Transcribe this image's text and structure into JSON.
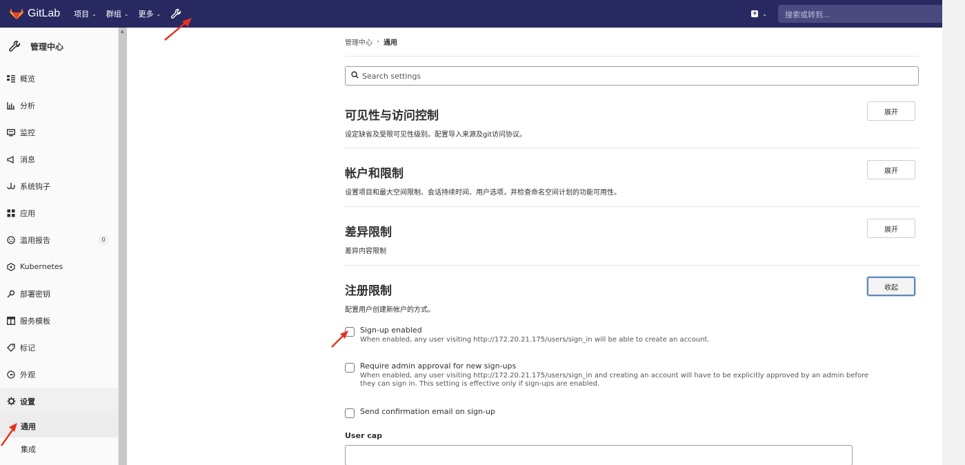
{
  "navbar": {
    "brand": "GitLab",
    "items": [
      {
        "label": "项目"
      },
      {
        "label": "群组"
      },
      {
        "label": "更多"
      }
    ],
    "search_placeholder": "搜索或转到..."
  },
  "sidebar": {
    "header": "管理中心",
    "items": [
      {
        "label": "概览",
        "icon": "overview-icon"
      },
      {
        "label": "分析",
        "icon": "chart-icon"
      },
      {
        "label": "监控",
        "icon": "monitor-icon"
      },
      {
        "label": "消息",
        "icon": "megaphone-icon"
      },
      {
        "label": "系统钩子",
        "icon": "hook-icon"
      },
      {
        "label": "应用",
        "icon": "apps-icon"
      },
      {
        "label": "滥用报告",
        "icon": "abuse-icon",
        "badge": "0"
      },
      {
        "label": "Kubernetes",
        "icon": "kubernetes-icon"
      },
      {
        "label": "部署密钥",
        "icon": "key-icon"
      },
      {
        "label": "服务模板",
        "icon": "template-icon"
      },
      {
        "label": "标记",
        "icon": "label-icon"
      },
      {
        "label": "外观",
        "icon": "appearance-icon"
      },
      {
        "label": "设置",
        "icon": "gear-icon"
      }
    ],
    "subitems": [
      {
        "label": "通用"
      },
      {
        "label": "集成"
      }
    ]
  },
  "breadcrumb": {
    "parent": "管理中心",
    "current": "通用"
  },
  "search_settings": {
    "placeholder": "Search settings"
  },
  "sections": [
    {
      "title": "可见性与访问控制",
      "desc": "设定缺省及受限可见性级别。配置导入来源及git访问协议。",
      "button": "展开"
    },
    {
      "title": "帐户和限制",
      "desc": "设置项目和最大空间限制、会话持续时间、用户选项，并检查命名空间计划的功能可用性。",
      "button": "展开"
    },
    {
      "title": "差异限制",
      "desc": "差异内容限制",
      "button": "展开"
    },
    {
      "title": "注册限制",
      "desc": "配置用户创建新帐户的方式。",
      "button": "收起"
    }
  ],
  "signup": {
    "enabled_label": "Sign-up enabled",
    "enabled_help": "When enabled, any user visiting http://172.20.21.175/users/sign_in will be able to create an account.",
    "approval_label": "Require admin approval for new sign-ups",
    "approval_help": "When enabled, any user visiting http://172.20.21.175/users/sign_in and creating an account will have to be explicitly approved by an admin before they can sign in. This setting is effective only if sign-ups are enabled.",
    "confirm_label": "Send confirmation email on sign-up",
    "user_cap_label": "User cap"
  },
  "colors": {
    "navbar": "#292961",
    "annotation_arrow": "#e8321e",
    "focus_border": "#5d89b5"
  }
}
